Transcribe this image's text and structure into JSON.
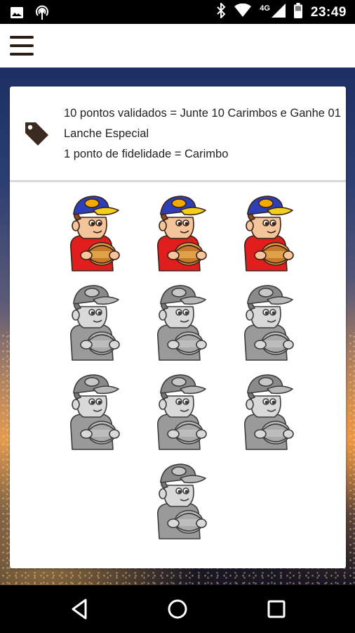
{
  "status_bar": {
    "time": "23:49",
    "network": "4G",
    "icons": [
      "image-icon",
      "podcast-icon",
      "bluetooth-icon",
      "wifi-icon",
      "signal-icon",
      "battery-icon"
    ]
  },
  "app_bar": {
    "menu_icon": "hamburger-menu-icon"
  },
  "loyalty_card": {
    "icon": "tag-icon",
    "line1": "10 pontos validados = Junte 10 Carimbos e Ganhe 01 Lanche Especial",
    "line2": "1 ponto de fidelidade = Carimbo",
    "total_stamps": 10,
    "collected_stamps": 3
  },
  "nav_bar": {
    "icons": [
      "back-icon",
      "home-icon",
      "recents-icon"
    ]
  },
  "colors": {
    "menu_icon": "#2b1d14",
    "tag_icon": "#3a2a20",
    "card_bg": "#ffffff",
    "divider": "#d9d9d9"
  }
}
